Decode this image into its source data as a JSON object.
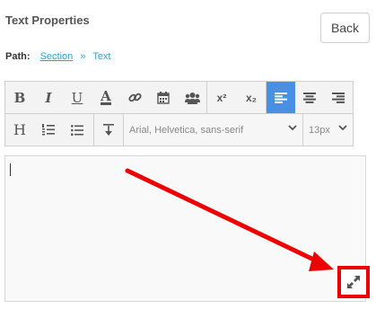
{
  "header": {
    "title": "Text Properties",
    "back_label": "Back"
  },
  "path": {
    "label": "Path:",
    "items": [
      {
        "label": "Section",
        "link": true
      },
      {
        "label": "Text",
        "link": false
      }
    ],
    "separator": "»"
  },
  "toolbar": {
    "row1": [
      {
        "name": "bold-button",
        "glyph": "B",
        "icon": "bold-icon"
      },
      {
        "name": "italic-button",
        "glyph": "I",
        "icon": "italic-icon"
      },
      {
        "name": "underline-button",
        "glyph": "U",
        "icon": "underline-icon"
      },
      {
        "name": "font-color-button",
        "glyph": "A",
        "icon": "font-color-icon"
      },
      {
        "name": "link-button",
        "glyph": "",
        "icon": "link-icon"
      },
      {
        "name": "calendar-button",
        "glyph": "",
        "icon": "calendar-icon"
      },
      {
        "name": "users-button",
        "glyph": "",
        "icon": "users-icon"
      },
      {
        "name": "superscript-button",
        "glyph": "x²",
        "icon": "superscript-icon"
      },
      {
        "name": "subscript-button",
        "glyph": "x₂",
        "icon": "subscript-icon"
      },
      {
        "name": "align-left-button",
        "glyph": "",
        "icon": "align-left-icon"
      },
      {
        "name": "align-center-button",
        "glyph": "",
        "icon": "align-center-icon"
      },
      {
        "name": "align-right-button",
        "glyph": "",
        "icon": "align-right-icon"
      }
    ],
    "row2_heading_glyph": "H",
    "font_family": "Arial, Helvetica, sans-serif",
    "font_size": "13px"
  },
  "editor": {
    "content": ""
  },
  "colors": {
    "accent": "#4a90e2",
    "link": "#2aa6c8",
    "highlight": "#ee0000"
  }
}
